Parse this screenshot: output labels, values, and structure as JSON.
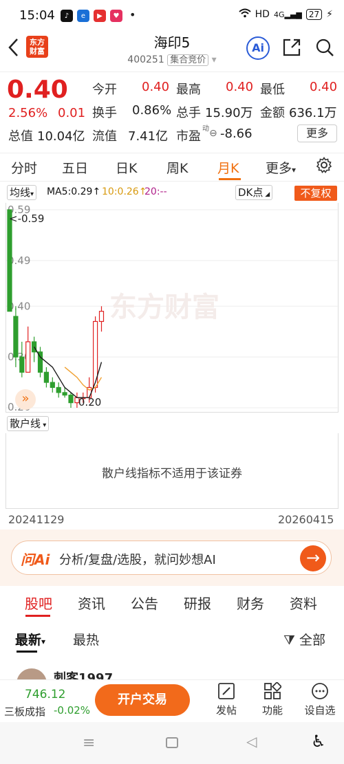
{
  "status": {
    "time": "15:04",
    "hd": "HD",
    "net": "4G",
    "battery": "27"
  },
  "header": {
    "logo_line1": "东方",
    "logo_line2": "财富",
    "title": "海印5",
    "code": "400251",
    "tag": "集合竞价"
  },
  "quote": {
    "price": "0.40",
    "pct": "2.56%",
    "change": "0.01",
    "open_label": "今开",
    "open": "0.40",
    "high_label": "最高",
    "high": "0.40",
    "low_label": "最低",
    "low": "0.40",
    "turnover_label": "换手",
    "turnover": "0.86%",
    "volume_label": "总手",
    "volume": "15.90万",
    "amount_label": "金额",
    "amount": "636.1万",
    "mktcap_label": "总值",
    "mktcap": "10.04亿",
    "float_label": "流值",
    "float": "7.41亿",
    "pe_label": "市盈",
    "pe_sup": "动",
    "pe": "-8.66",
    "more": "更多"
  },
  "tabs": [
    "分时",
    "五日",
    "日K",
    "周K",
    "月K",
    "更多"
  ],
  "chart": {
    "avg_label": "均线",
    "ma5": "MA5:0.29↑",
    "ma10": "10:0.26↑",
    "ma20": "20:--",
    "dk": "DK点",
    "nofq": "不复权",
    "y_labels": [
      "0.59",
      "0.49",
      "0.40",
      "0.30",
      "0.20"
    ],
    "max_label": "<-0.59",
    "min_label": "0.20",
    "watermark": "东方财富",
    "colors": {
      "up": "#e02020",
      "down": "#2e9e2e",
      "ma5": "#1a1a1a",
      "ma10": "#f0a030"
    }
  },
  "chart_data": {
    "type": "candlestick",
    "ylim": [
      0.2,
      0.59
    ],
    "candles": [
      {
        "o": 0.59,
        "h": 0.59,
        "l": 0.39,
        "c": 0.39
      },
      {
        "o": 0.38,
        "h": 0.4,
        "l": 0.28,
        "c": 0.3
      },
      {
        "o": 0.3,
        "h": 0.33,
        "l": 0.26,
        "c": 0.27
      },
      {
        "o": 0.27,
        "h": 0.36,
        "l": 0.27,
        "c": 0.33
      },
      {
        "o": 0.33,
        "h": 0.34,
        "l": 0.29,
        "c": 0.31
      },
      {
        "o": 0.31,
        "h": 0.32,
        "l": 0.26,
        "c": 0.27
      },
      {
        "o": 0.27,
        "h": 0.28,
        "l": 0.24,
        "c": 0.25
      },
      {
        "o": 0.25,
        "h": 0.26,
        "l": 0.23,
        "c": 0.24
      },
      {
        "o": 0.24,
        "h": 0.25,
        "l": 0.22,
        "c": 0.23
      },
      {
        "o": 0.23,
        "h": 0.24,
        "l": 0.22,
        "c": 0.225
      },
      {
        "o": 0.225,
        "h": 0.23,
        "l": 0.2,
        "c": 0.21
      },
      {
        "o": 0.21,
        "h": 0.23,
        "l": 0.2,
        "c": 0.22
      },
      {
        "o": 0.22,
        "h": 0.23,
        "l": 0.21,
        "c": 0.22
      },
      {
        "o": 0.22,
        "h": 0.26,
        "l": 0.21,
        "c": 0.24
      },
      {
        "o": 0.24,
        "h": 0.38,
        "l": 0.23,
        "c": 0.37
      },
      {
        "o": 0.37,
        "h": 0.4,
        "l": 0.35,
        "c": 0.39
      }
    ],
    "ma5": [
      null,
      null,
      null,
      null,
      0.32,
      0.3,
      0.29,
      0.28,
      0.26,
      0.24,
      0.23,
      0.22,
      0.22,
      0.22,
      0.25,
      0.29
    ],
    "ma10": [
      null,
      null,
      null,
      null,
      null,
      null,
      null,
      null,
      null,
      0.28,
      0.27,
      0.26,
      0.245,
      0.235,
      0.24,
      0.26
    ]
  },
  "scatter": {
    "label": "散户线",
    "message": "散户线指标不适用于该证券"
  },
  "dates": {
    "start": "20241129",
    "end": "20260415"
  },
  "ai": {
    "logo": "问Ai",
    "text": "分析/复盘/选股，就问妙想AI"
  },
  "news_tabs": [
    "股吧",
    "资讯",
    "公告",
    "研报",
    "财务",
    "资料"
  ],
  "sort": {
    "newest": "最新",
    "hottest": "最热",
    "filter": "全部"
  },
  "post": {
    "user": "刺客1997"
  },
  "bottom": {
    "index_value": "746.12",
    "index_name": "三板成指",
    "index_change": "-0.02%",
    "trade": "开户交易",
    "post": "发帖",
    "func": "功能",
    "watch": "设自选"
  }
}
